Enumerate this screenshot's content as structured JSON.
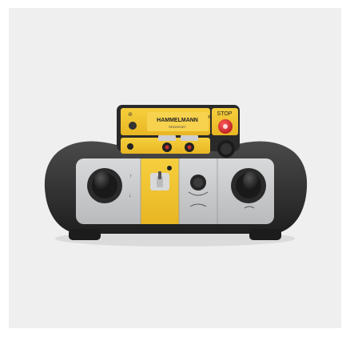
{
  "product": {
    "brand": "HAMMELMANN",
    "brand_mark": "®",
    "model": "SPIDERJET",
    "stop_label": "STOP"
  },
  "colors": {
    "background": "#efefef",
    "body_black": "#2b2b2b",
    "panel_yellow": "#f2c430",
    "panel_gray": "#c9cacb",
    "stop_red": "#d9282f"
  },
  "controls": {
    "left_joystick": "joystick-icon",
    "right_joystick": "joystick-icon",
    "center_knob": "rotary-knob-icon",
    "toggle_switch": "toggle-switch-icon",
    "emergency_stop": "emergency-stop-icon"
  }
}
